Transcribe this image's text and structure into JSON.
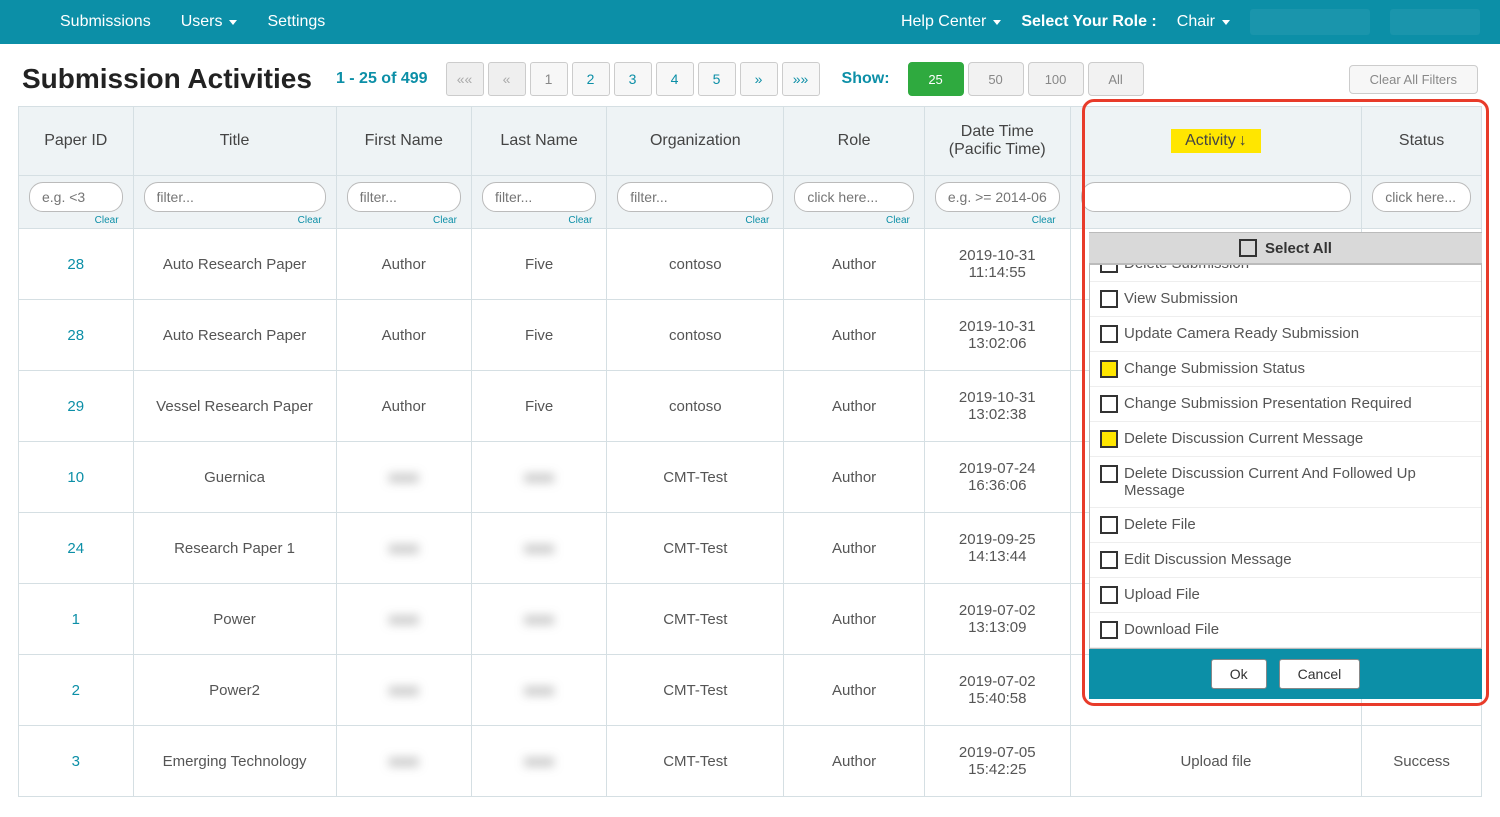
{
  "nav": {
    "submissions": "Submissions",
    "users": "Users",
    "settings": "Settings",
    "help": "Help Center",
    "role_label": "Select Your Role :",
    "role_value": "Chair"
  },
  "header": {
    "title": "Submission Activities",
    "pager_info": "1 - 25 of 499",
    "pager": {
      "first": "««",
      "prev": "«",
      "p1": "1",
      "p2": "2",
      "p3": "3",
      "p4": "4",
      "p5": "5",
      "next": "»",
      "last": "»»"
    },
    "show_label": "Show:",
    "show": {
      "b25": "25",
      "b50": "50",
      "b100": "100",
      "ball": "All"
    },
    "clear_filters": "Clear All Filters"
  },
  "columns": {
    "paper_id": "Paper ID",
    "title": "Title",
    "first_name": "First Name",
    "last_name": "Last Name",
    "org": "Organization",
    "role": "Role",
    "datetime": "Date Time (Pacific Time)",
    "activity": "Activity",
    "status": "Status"
  },
  "filters": {
    "paper_id_ph": "e.g. <3",
    "text_ph": "filter...",
    "click_ph": "click here...",
    "date_ph": "e.g. >= 2014-06-",
    "clear": "Clear"
  },
  "rows": [
    {
      "id": "28",
      "title": "Auto Research Paper",
      "fn": "Author",
      "ln": "Five",
      "org": "contoso",
      "role": "Author",
      "dt": "2019-10-31 11:14:55"
    },
    {
      "id": "28",
      "title": "Auto Research Paper",
      "fn": "Author",
      "ln": "Five",
      "org": "contoso",
      "role": "Author",
      "dt": "2019-10-31 13:02:06"
    },
    {
      "id": "29",
      "title": "Vessel Research Paper",
      "fn": "Author",
      "ln": "Five",
      "org": "contoso",
      "role": "Author",
      "dt": "2019-10-31 13:02:38"
    },
    {
      "id": "10",
      "title": "Guernica",
      "fn": "",
      "ln": "",
      "org": "CMT-Test",
      "role": "Author",
      "dt": "2019-07-24 16:36:06",
      "blur": true
    },
    {
      "id": "24",
      "title": "Research Paper 1",
      "fn": "",
      "ln": "",
      "org": "CMT-Test",
      "role": "Author",
      "dt": "2019-09-25 14:13:44",
      "blur": true
    },
    {
      "id": "1",
      "title": "Power",
      "fn": "",
      "ln": "",
      "org": "CMT-Test",
      "role": "Author",
      "dt": "2019-07-02 13:13:09",
      "blur": true
    },
    {
      "id": "2",
      "title": "Power2",
      "fn": "",
      "ln": "",
      "org": "CMT-Test",
      "role": "Author",
      "dt": "2019-07-02 15:40:58",
      "blur": true
    },
    {
      "id": "3",
      "title": "Emerging Technology",
      "fn": "",
      "ln": "",
      "org": "CMT-Test",
      "role": "Author",
      "dt": "2019-07-05 15:42:25",
      "blur": true,
      "activity": "Upload file",
      "status": "Success"
    }
  ],
  "dropdown": {
    "select_all": "Select All",
    "items": [
      {
        "label": "Delete Submission",
        "hilite": false,
        "partial_top": true
      },
      {
        "label": "View Submission",
        "hilite": false
      },
      {
        "label": "Update Camera Ready Submission",
        "hilite": false
      },
      {
        "label": "Change Submission Status",
        "hilite": true
      },
      {
        "label": "Change Submission Presentation Required",
        "hilite": false
      },
      {
        "label": "Delete Discussion Current Message",
        "hilite": true
      },
      {
        "label": "Delete Discussion Current And Followed Up Message",
        "hilite": false
      },
      {
        "label": "Delete File",
        "hilite": false
      },
      {
        "label": "Edit Discussion Message",
        "hilite": false
      },
      {
        "label": "Upload File",
        "hilite": false
      },
      {
        "label": "Download File",
        "hilite": false
      }
    ],
    "ok": "Ok",
    "cancel": "Cancel"
  }
}
